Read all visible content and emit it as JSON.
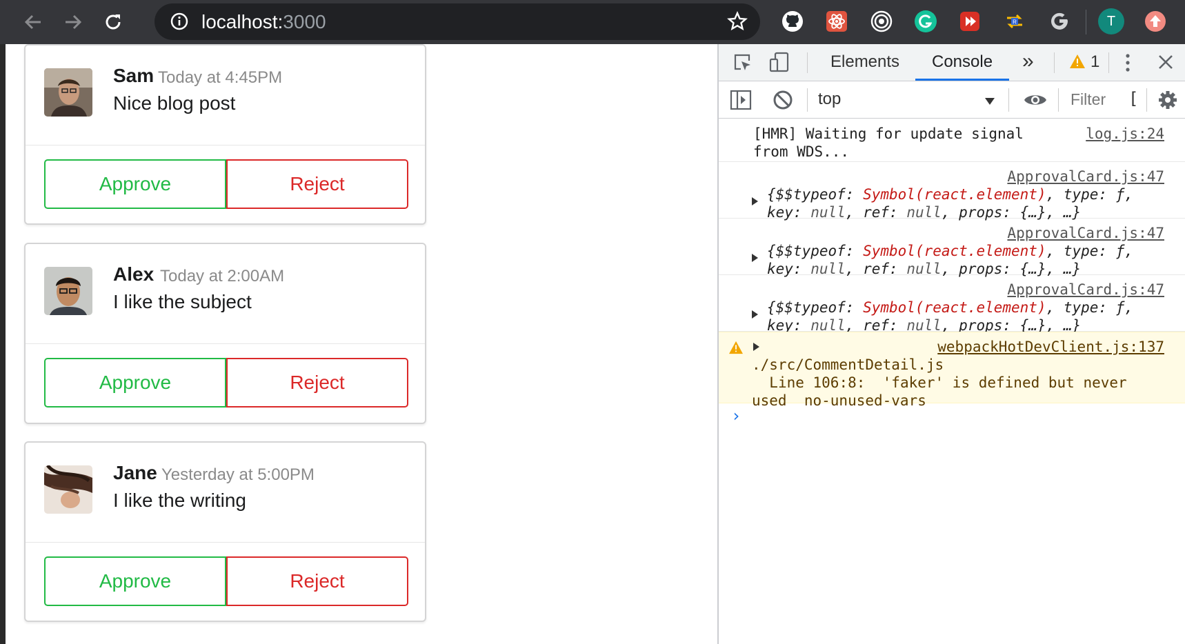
{
  "browser": {
    "url_host": "localhost:",
    "url_port": "3000",
    "profile_initial": "T"
  },
  "comments": [
    {
      "author": "Sam",
      "meta": "Today at 4:45PM",
      "text": "Nice blog post",
      "approve_label": "Approve",
      "reject_label": "Reject"
    },
    {
      "author": "Alex",
      "meta": "Today at 2:00AM",
      "text": "I like the subject",
      "approve_label": "Approve",
      "reject_label": "Reject"
    },
    {
      "author": "Jane",
      "meta": "Yesterday at 5:00PM",
      "text": "I like the writing",
      "approve_label": "Approve",
      "reject_label": "Reject"
    }
  ],
  "devtools": {
    "tabs": {
      "elements": "Elements",
      "console": "Console",
      "more": "»"
    },
    "warning_count": "1",
    "context": "top",
    "filter_placeholder": "Filter",
    "messages": {
      "hmr_text": "[HMR] Waiting for update signal from WDS...",
      "hmr_src": "log.js:24",
      "obj_src": "ApprovalCard.js:47",
      "warn_src": "webpackHotDevClient.js:137",
      "warn_line1": "./src/CommentDetail.js",
      "warn_line2": "  Line 106:8:  'faker' is defined but never used  no-unused-vars"
    }
  },
  "colors": {
    "approve": "#21ba45",
    "reject": "#db2828",
    "chrome": "#35363a",
    "accent": "#1a73e8"
  }
}
